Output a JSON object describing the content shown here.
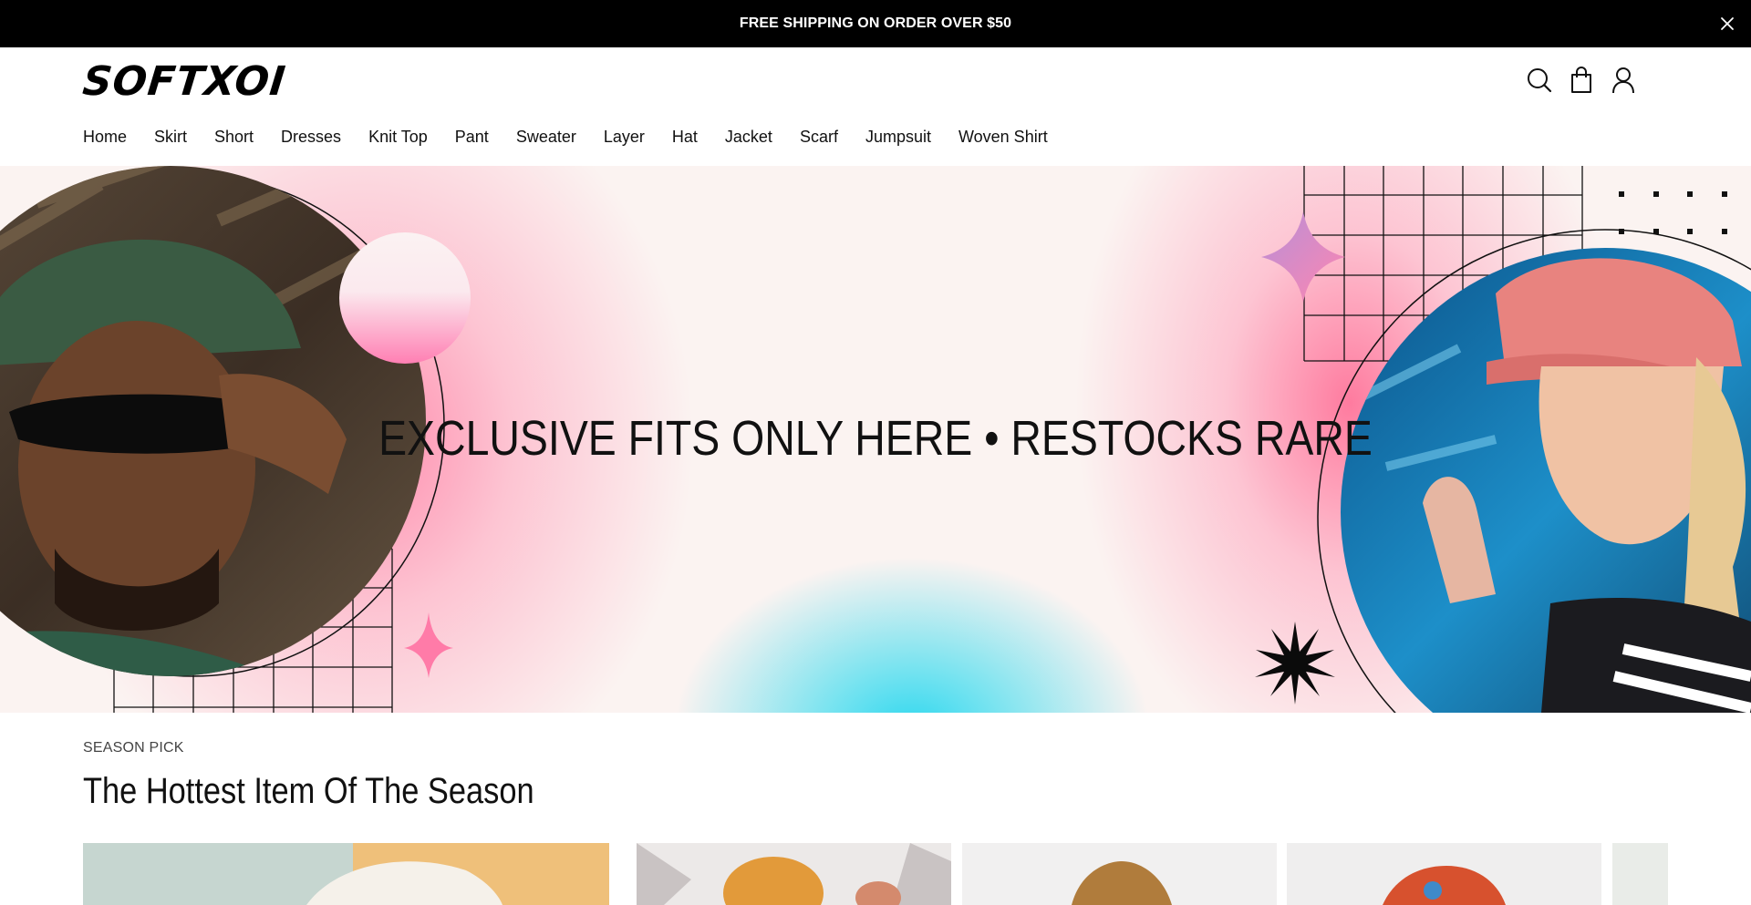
{
  "announcement": {
    "text": "FREE SHIPPING ON ORDER OVER $50",
    "close_icon": "close-icon"
  },
  "header": {
    "logo": "SOFTXOI",
    "icons": [
      "search-icon",
      "cart-icon",
      "user-icon"
    ]
  },
  "nav": {
    "items": [
      "Home",
      "Skirt",
      "Short",
      "Dresses",
      "Knit Top",
      "Pant",
      "Sweater",
      "Layer",
      "Hat",
      "Jacket",
      "Scarf",
      "Jumpsuit",
      "Woven Shirt"
    ]
  },
  "hero": {
    "headline": "EXCLUSIVE FITS ONLY HERE • RESTOCKS RARE"
  },
  "season": {
    "eyebrow": "SEASON PICK",
    "title": "The Hottest Item Of The Season"
  },
  "colors": {
    "announce_bg": "#000000",
    "hero_pink": "#ff6f9a",
    "hero_cyan": "#24d6ee",
    "text": "#111111"
  }
}
